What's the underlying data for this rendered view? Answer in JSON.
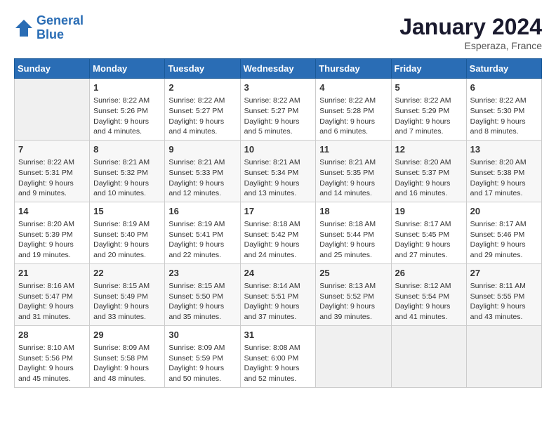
{
  "header": {
    "logo_line1": "General",
    "logo_line2": "Blue",
    "month": "January 2024",
    "location": "Esperaza, France"
  },
  "days_of_week": [
    "Sunday",
    "Monday",
    "Tuesday",
    "Wednesday",
    "Thursday",
    "Friday",
    "Saturday"
  ],
  "weeks": [
    [
      {
        "day": "",
        "info": ""
      },
      {
        "day": "1",
        "info": "Sunrise: 8:22 AM\nSunset: 5:26 PM\nDaylight: 9 hours\nand 4 minutes."
      },
      {
        "day": "2",
        "info": "Sunrise: 8:22 AM\nSunset: 5:27 PM\nDaylight: 9 hours\nand 4 minutes."
      },
      {
        "day": "3",
        "info": "Sunrise: 8:22 AM\nSunset: 5:27 PM\nDaylight: 9 hours\nand 5 minutes."
      },
      {
        "day": "4",
        "info": "Sunrise: 8:22 AM\nSunset: 5:28 PM\nDaylight: 9 hours\nand 6 minutes."
      },
      {
        "day": "5",
        "info": "Sunrise: 8:22 AM\nSunset: 5:29 PM\nDaylight: 9 hours\nand 7 minutes."
      },
      {
        "day": "6",
        "info": "Sunrise: 8:22 AM\nSunset: 5:30 PM\nDaylight: 9 hours\nand 8 minutes."
      }
    ],
    [
      {
        "day": "7",
        "info": "Sunrise: 8:22 AM\nSunset: 5:31 PM\nDaylight: 9 hours\nand 9 minutes."
      },
      {
        "day": "8",
        "info": "Sunrise: 8:21 AM\nSunset: 5:32 PM\nDaylight: 9 hours\nand 10 minutes."
      },
      {
        "day": "9",
        "info": "Sunrise: 8:21 AM\nSunset: 5:33 PM\nDaylight: 9 hours\nand 12 minutes."
      },
      {
        "day": "10",
        "info": "Sunrise: 8:21 AM\nSunset: 5:34 PM\nDaylight: 9 hours\nand 13 minutes."
      },
      {
        "day": "11",
        "info": "Sunrise: 8:21 AM\nSunset: 5:35 PM\nDaylight: 9 hours\nand 14 minutes."
      },
      {
        "day": "12",
        "info": "Sunrise: 8:20 AM\nSunset: 5:37 PM\nDaylight: 9 hours\nand 16 minutes."
      },
      {
        "day": "13",
        "info": "Sunrise: 8:20 AM\nSunset: 5:38 PM\nDaylight: 9 hours\nand 17 minutes."
      }
    ],
    [
      {
        "day": "14",
        "info": "Sunrise: 8:20 AM\nSunset: 5:39 PM\nDaylight: 9 hours\nand 19 minutes."
      },
      {
        "day": "15",
        "info": "Sunrise: 8:19 AM\nSunset: 5:40 PM\nDaylight: 9 hours\nand 20 minutes."
      },
      {
        "day": "16",
        "info": "Sunrise: 8:19 AM\nSunset: 5:41 PM\nDaylight: 9 hours\nand 22 minutes."
      },
      {
        "day": "17",
        "info": "Sunrise: 8:18 AM\nSunset: 5:42 PM\nDaylight: 9 hours\nand 24 minutes."
      },
      {
        "day": "18",
        "info": "Sunrise: 8:18 AM\nSunset: 5:44 PM\nDaylight: 9 hours\nand 25 minutes."
      },
      {
        "day": "19",
        "info": "Sunrise: 8:17 AM\nSunset: 5:45 PM\nDaylight: 9 hours\nand 27 minutes."
      },
      {
        "day": "20",
        "info": "Sunrise: 8:17 AM\nSunset: 5:46 PM\nDaylight: 9 hours\nand 29 minutes."
      }
    ],
    [
      {
        "day": "21",
        "info": "Sunrise: 8:16 AM\nSunset: 5:47 PM\nDaylight: 9 hours\nand 31 minutes."
      },
      {
        "day": "22",
        "info": "Sunrise: 8:15 AM\nSunset: 5:49 PM\nDaylight: 9 hours\nand 33 minutes."
      },
      {
        "day": "23",
        "info": "Sunrise: 8:15 AM\nSunset: 5:50 PM\nDaylight: 9 hours\nand 35 minutes."
      },
      {
        "day": "24",
        "info": "Sunrise: 8:14 AM\nSunset: 5:51 PM\nDaylight: 9 hours\nand 37 minutes."
      },
      {
        "day": "25",
        "info": "Sunrise: 8:13 AM\nSunset: 5:52 PM\nDaylight: 9 hours\nand 39 minutes."
      },
      {
        "day": "26",
        "info": "Sunrise: 8:12 AM\nSunset: 5:54 PM\nDaylight: 9 hours\nand 41 minutes."
      },
      {
        "day": "27",
        "info": "Sunrise: 8:11 AM\nSunset: 5:55 PM\nDaylight: 9 hours\nand 43 minutes."
      }
    ],
    [
      {
        "day": "28",
        "info": "Sunrise: 8:10 AM\nSunset: 5:56 PM\nDaylight: 9 hours\nand 45 minutes."
      },
      {
        "day": "29",
        "info": "Sunrise: 8:09 AM\nSunset: 5:58 PM\nDaylight: 9 hours\nand 48 minutes."
      },
      {
        "day": "30",
        "info": "Sunrise: 8:09 AM\nSunset: 5:59 PM\nDaylight: 9 hours\nand 50 minutes."
      },
      {
        "day": "31",
        "info": "Sunrise: 8:08 AM\nSunset: 6:00 PM\nDaylight: 9 hours\nand 52 minutes."
      },
      {
        "day": "",
        "info": ""
      },
      {
        "day": "",
        "info": ""
      },
      {
        "day": "",
        "info": ""
      }
    ]
  ]
}
